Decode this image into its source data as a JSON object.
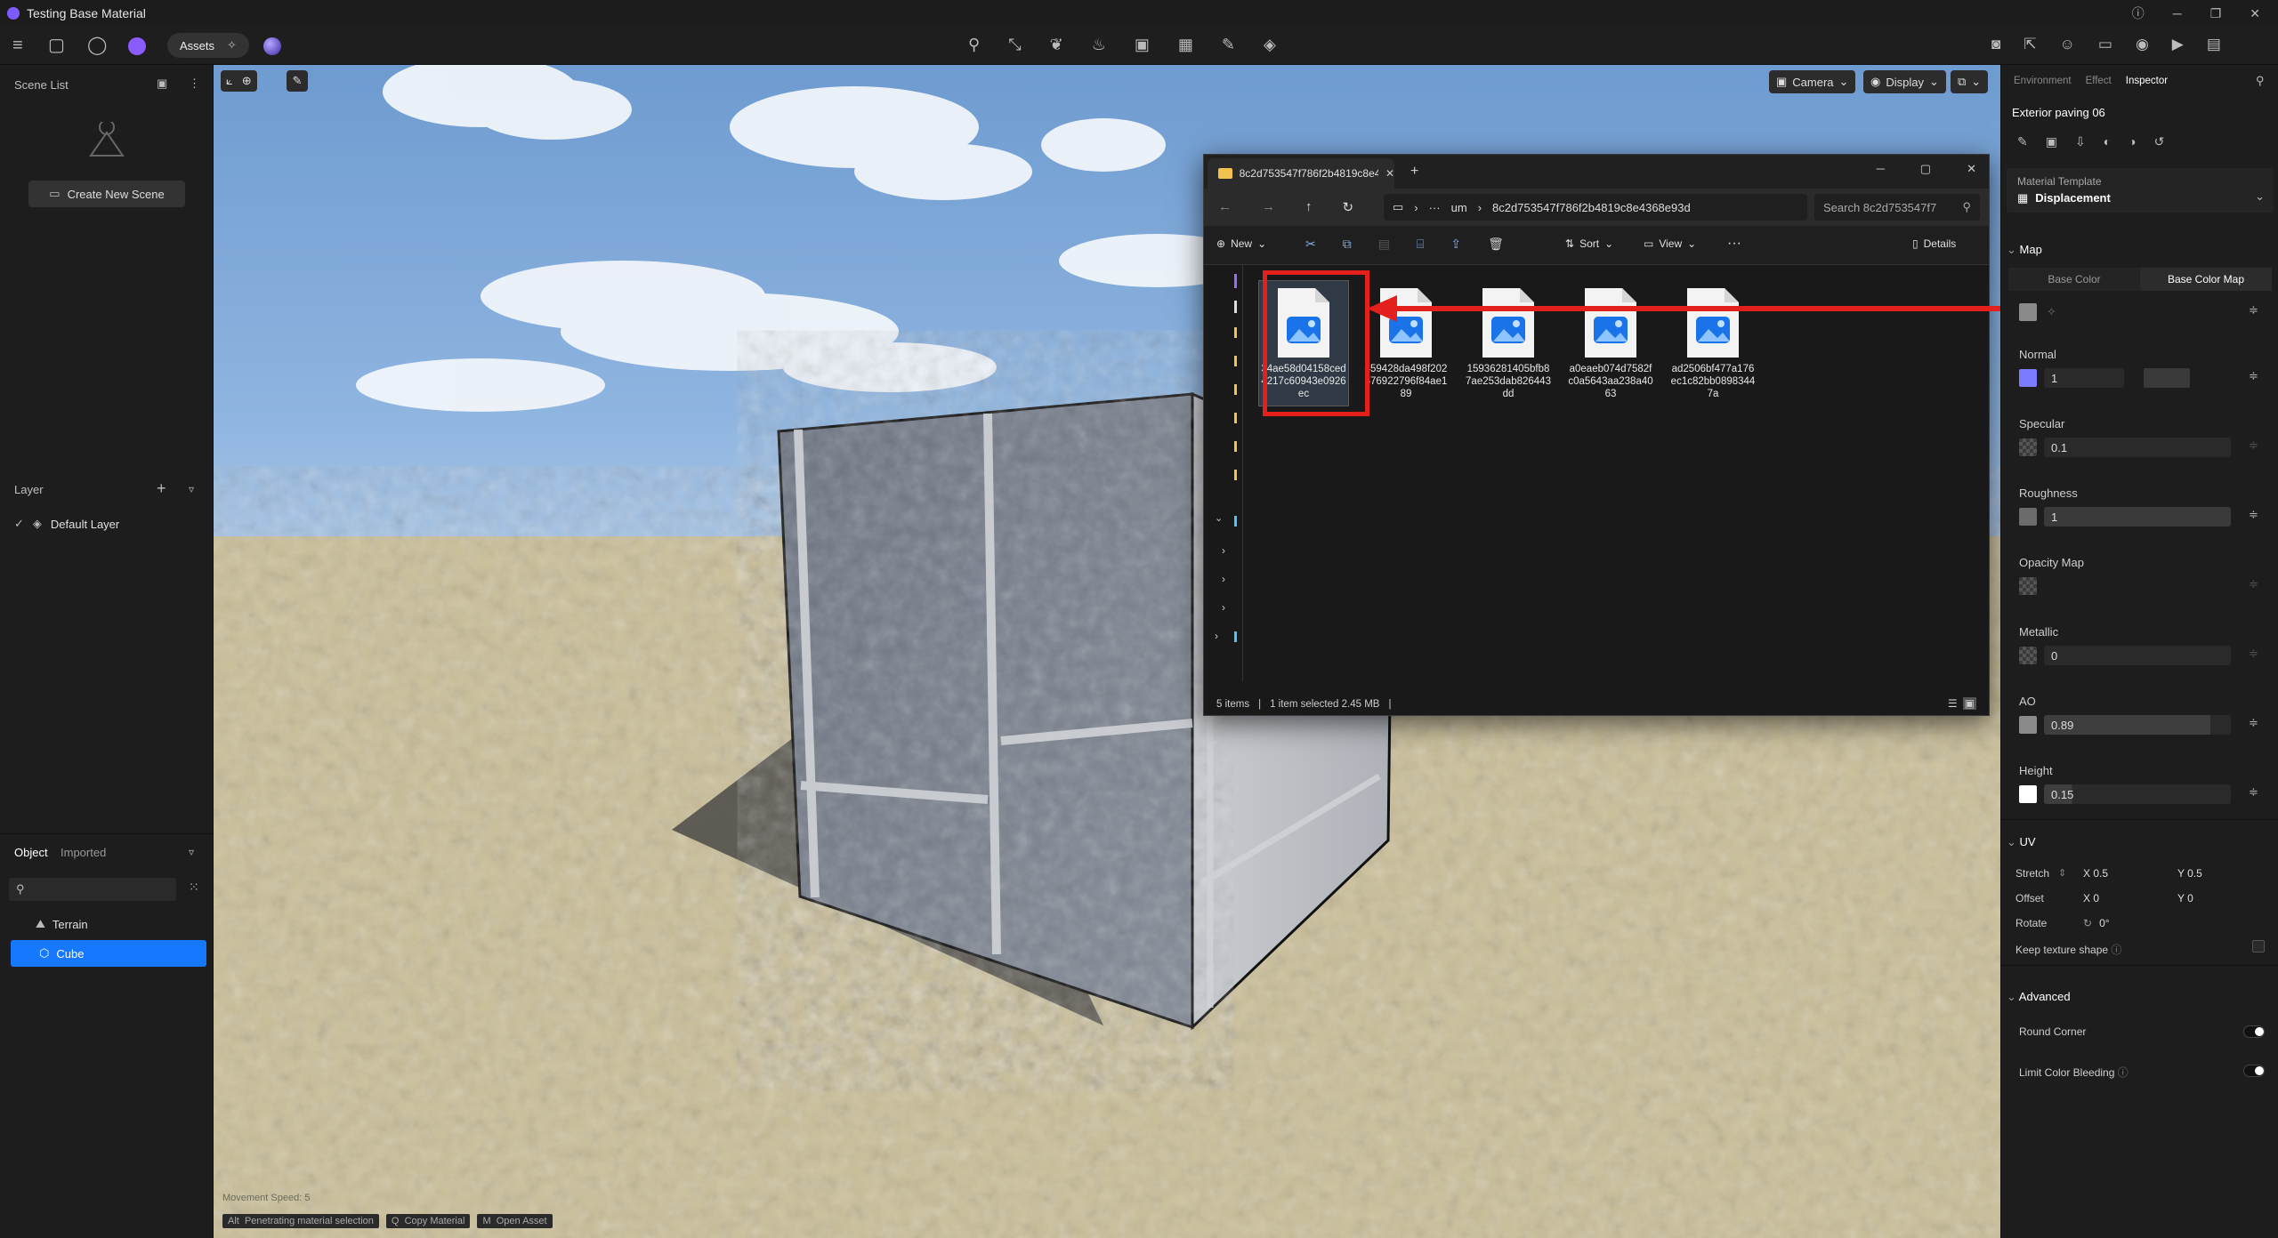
{
  "app": {
    "title": "Testing Base Material"
  },
  "toolbar": {
    "assets_label": "Assets"
  },
  "scene_list": {
    "title": "Scene List",
    "create_button": "Create New Scene"
  },
  "layer": {
    "title": "Layer",
    "items": [
      "Default Layer"
    ]
  },
  "object_panel": {
    "tabs": [
      "Object",
      "Imported"
    ],
    "search_placeholder": "",
    "items": [
      "Terrain",
      "Cube"
    ],
    "selected": "Cube"
  },
  "viewport": {
    "camera_label": "Camera",
    "display_label": "Display",
    "movement_speed": "Movement Speed: 5",
    "hints": [
      {
        "key": "Alt",
        "label": "Penetrating material selection"
      },
      {
        "key": "Q",
        "label": "Copy Material"
      },
      {
        "key": "M",
        "label": "Open Asset"
      }
    ]
  },
  "explorer": {
    "tab_title": "8c2d753547f786f2b4819c8e4:",
    "address_prefix": "um",
    "address": "8c2d753547f786f2b4819c8e4368e93d",
    "search_placeholder": "Search 8c2d753547f7",
    "commands": {
      "new": "New",
      "sort": "Sort",
      "view": "View",
      "details": "Details"
    },
    "files": [
      "34ae58d04158ced4217c60943e0926ec",
      "459428da498f202676922796f84ae189",
      "15936281405bfb87ae253dab826443dd",
      "a0eaeb074d7582fc0a5643aa238a4063",
      "ad2506bf477a176ec1c82bb08983447a"
    ],
    "status": {
      "count": "5 items",
      "selected": "1 item selected  2.45 MB"
    }
  },
  "inspector": {
    "tabs": [
      "Environment",
      "Effect",
      "Inspector"
    ],
    "material_name": "Exterior paving 06",
    "template_label": "Material Template",
    "template_value": "Displacement",
    "map_section": "Map",
    "map_tabs": [
      "Base Color",
      "Base Color Map"
    ],
    "normal": {
      "label": "Normal",
      "value": "1"
    },
    "specular": {
      "label": "Specular",
      "value": "0.1"
    },
    "roughness": {
      "label": "Roughness",
      "value": "1"
    },
    "opacity": {
      "label": "Opacity Map"
    },
    "metallic": {
      "label": "Metallic",
      "value": "0"
    },
    "ao": {
      "label": "AO",
      "value": "0.89"
    },
    "height": {
      "label": "Height",
      "value": "0.15"
    },
    "uv_section": "UV",
    "stretch": {
      "label": "Stretch",
      "x": "X 0.5",
      "y": "Y 0.5"
    },
    "offset": {
      "label": "Offset",
      "x": "X 0",
      "y": "Y 0"
    },
    "rotate": {
      "label": "Rotate",
      "value": "0°"
    },
    "keep_shape": "Keep texture shape",
    "advanced_section": "Advanced",
    "round_corner": "Round Corner",
    "limit_bleeding": "Limit Color Bleeding"
  },
  "colors": {
    "accent": "#1677ff",
    "highlight": "#e3201b",
    "normal_swatch": "#7b7bff"
  }
}
